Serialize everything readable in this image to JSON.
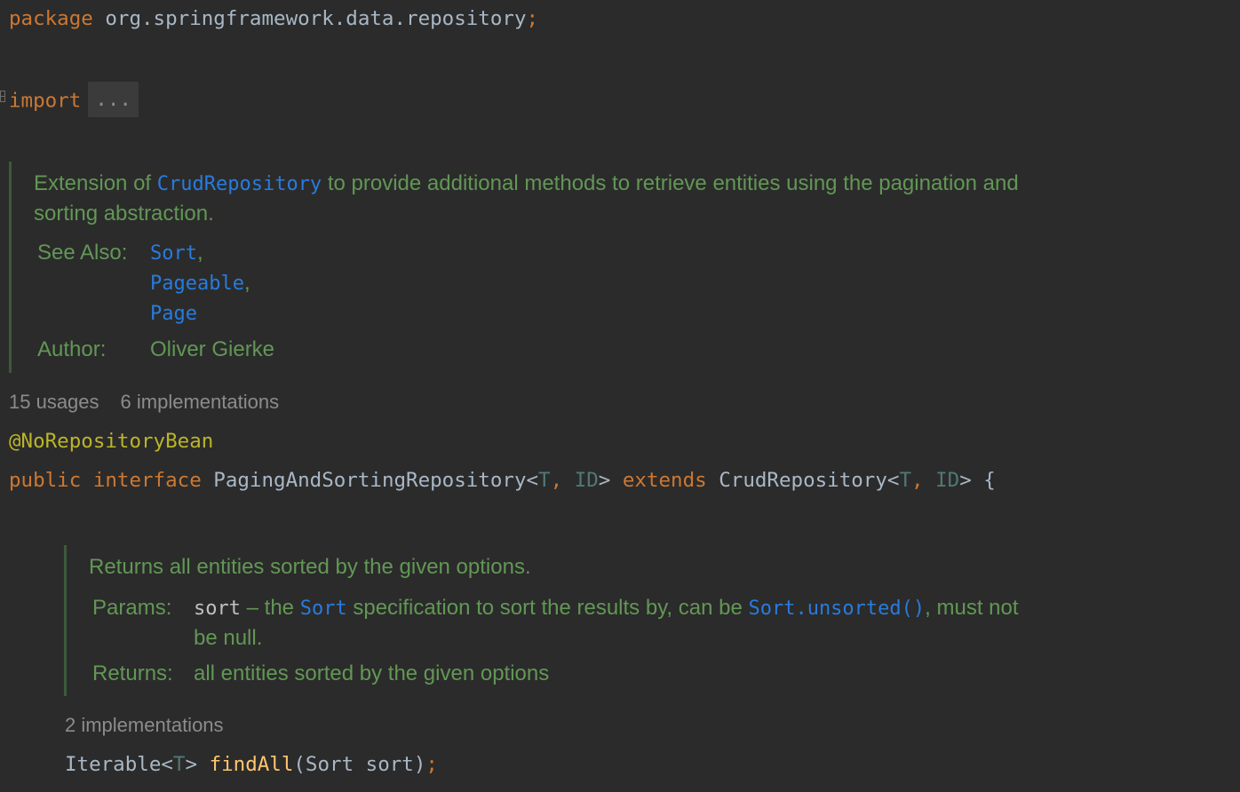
{
  "code": {
    "package_kw": "package",
    "package_name": "org.springframework.data.repository",
    "semicolon": ";",
    "import_kw": "import",
    "import_collapsed": "...",
    "annotation": "@NoRepositoryBean",
    "public_kw": "public",
    "interface_kw": "interface",
    "interface_name": "PagingAndSortingRepository",
    "lt": "<",
    "gt": ">",
    "type_param_t": "T",
    "comma_space": ", ",
    "type_param_id": "ID",
    "extends_kw": "extends",
    "super_name": "CrudRepository",
    "open_brace": " {",
    "method_return_type": "Iterable",
    "method_name": "findAll",
    "method_params": "(Sort sort)",
    "method_semicolon": ";"
  },
  "class_doc": {
    "text_before": "Extension of ",
    "link_crud": "CrudRepository",
    "text_after": " to provide additional methods to retrieve entities using the pagination and",
    "line2": "sorting abstraction.",
    "see_also_label": "See Also:",
    "see_also_items": [
      "Sort",
      "Pageable",
      "Page"
    ],
    "comma": ",",
    "author_label": "Author:",
    "author_value": "Oliver Gierke"
  },
  "class_hints": {
    "usages": "15 usages",
    "implementations": "6 implementations"
  },
  "method_doc": {
    "summary": "Returns all entities sorted by the given options.",
    "params_label": "Params:",
    "param_name": "sort",
    "param_text_1": " – the ",
    "param_link_sort": "Sort",
    "param_text_2": " specification to sort the results by, can be ",
    "param_link_unsorted": "Sort.unsorted()",
    "param_text_3": ", must not",
    "param_line2": "be null.",
    "returns_label": "Returns:",
    "returns_value": "all entities sorted by the given options"
  },
  "method_hints": {
    "implementations": "2 implementations"
  },
  "colors": {
    "background": "#2b2b2b",
    "keyword": "#cc7832",
    "identifier": "#a9b7c6",
    "annotation": "#bbb529",
    "type_param": "#507874",
    "method_name": "#ffc66d",
    "doc_text": "#629755",
    "doc_link": "#287bde",
    "hint_text": "#8c8c8c"
  }
}
